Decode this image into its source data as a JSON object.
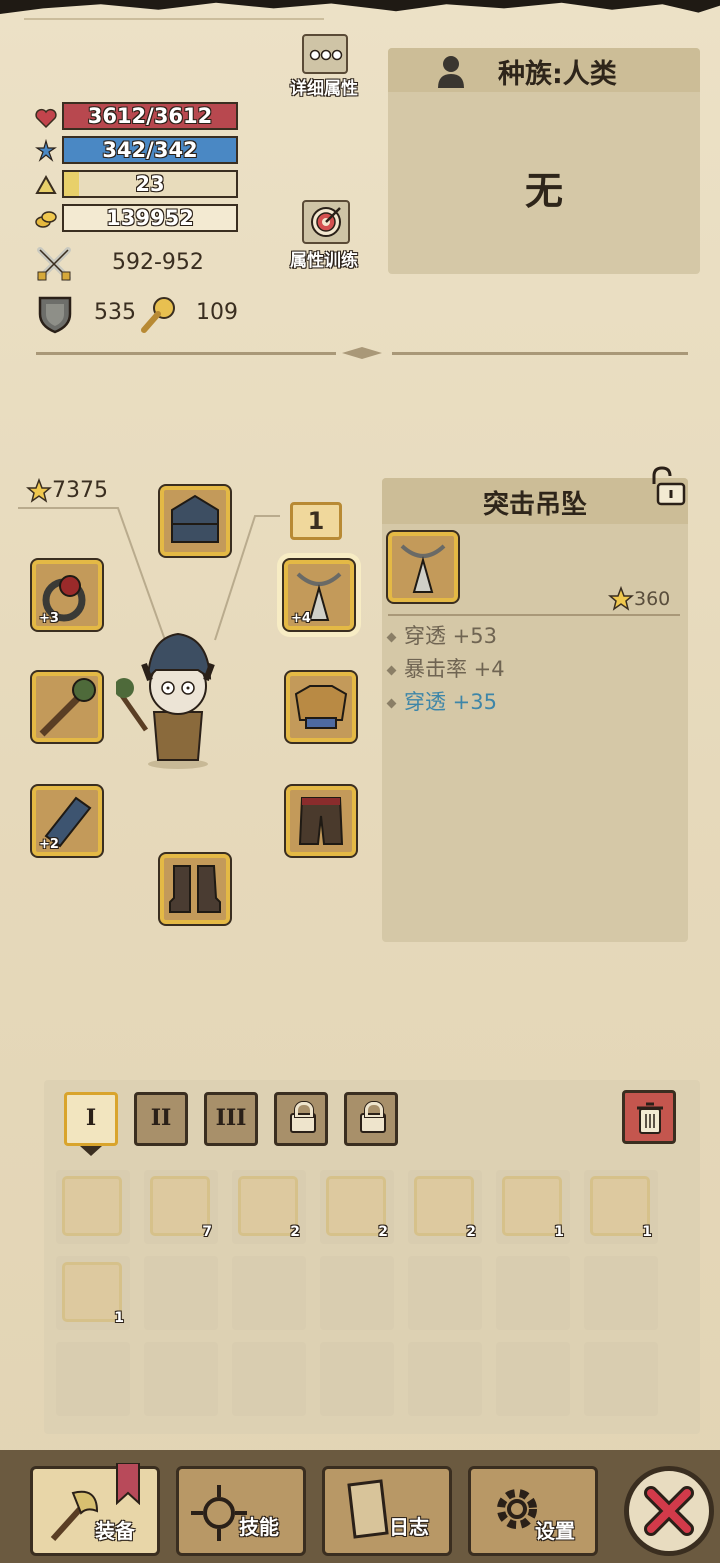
{
  "header": {
    "detail_button_label": "详细属性",
    "training_button_label": "属性训练"
  },
  "stats": {
    "hp": "3612/3612",
    "mp": "342/342",
    "level": "23",
    "level_progress": 0.09,
    "gold": "139952",
    "attack": "592-952",
    "defense": "535",
    "magic": "109"
  },
  "race_panel": {
    "title": "种族:人类",
    "value": "无"
  },
  "equipment": {
    "power_score": "7375",
    "set_number": "1",
    "slots": [
      {
        "name": "helmet",
        "plus": ""
      },
      {
        "name": "ring",
        "plus": "+3"
      },
      {
        "name": "weapon",
        "plus": ""
      },
      {
        "name": "bracer",
        "plus": "+2"
      },
      {
        "name": "boots",
        "plus": ""
      },
      {
        "name": "amulet",
        "plus": "+4"
      },
      {
        "name": "armor",
        "plus": ""
      },
      {
        "name": "pants",
        "plus": ""
      }
    ]
  },
  "item_detail": {
    "title": "突击吊坠",
    "score": "360",
    "attributes": [
      {
        "text": "穿透 +53",
        "color": "#6f6452"
      },
      {
        "text": "暴击率 +4",
        "color": "#6f6452"
      },
      {
        "text": "穿透 +35",
        "color": "#3e86a8"
      }
    ]
  },
  "inventory": {
    "tabs": [
      {
        "label": "I",
        "locked": false,
        "active": true
      },
      {
        "label": "II",
        "locked": false,
        "active": false
      },
      {
        "label": "III",
        "locked": false,
        "active": false
      },
      {
        "label": "",
        "locked": true,
        "active": false
      },
      {
        "label": "",
        "locked": true,
        "active": false
      }
    ],
    "items": [
      {
        "icon": "scroll-bag-icon",
        "count": ""
      },
      {
        "icon": "pickaxe-icon",
        "count": "7"
      },
      {
        "icon": "potion-blue-icon",
        "count": "2"
      },
      {
        "icon": "mushroom-icon",
        "count": "2"
      },
      {
        "icon": "meat-stick-icon",
        "count": "2"
      },
      {
        "icon": "herb-icon",
        "count": "1"
      },
      {
        "icon": "ore-icon",
        "count": "1"
      },
      {
        "icon": "potion-green-icon",
        "count": "1"
      }
    ]
  },
  "bottom_nav": {
    "items": [
      {
        "label": "装备"
      },
      {
        "label": "技能"
      },
      {
        "label": "日志"
      },
      {
        "label": "设置"
      }
    ]
  },
  "colors": {
    "hp_bar": "#b8484f",
    "mp_bar": "#4a88c4",
    "level_bar": "#e8d06a",
    "slot_border": "#e4b945",
    "paper": "#e8dcc0",
    "attr_highlight": "#3e86a8"
  }
}
